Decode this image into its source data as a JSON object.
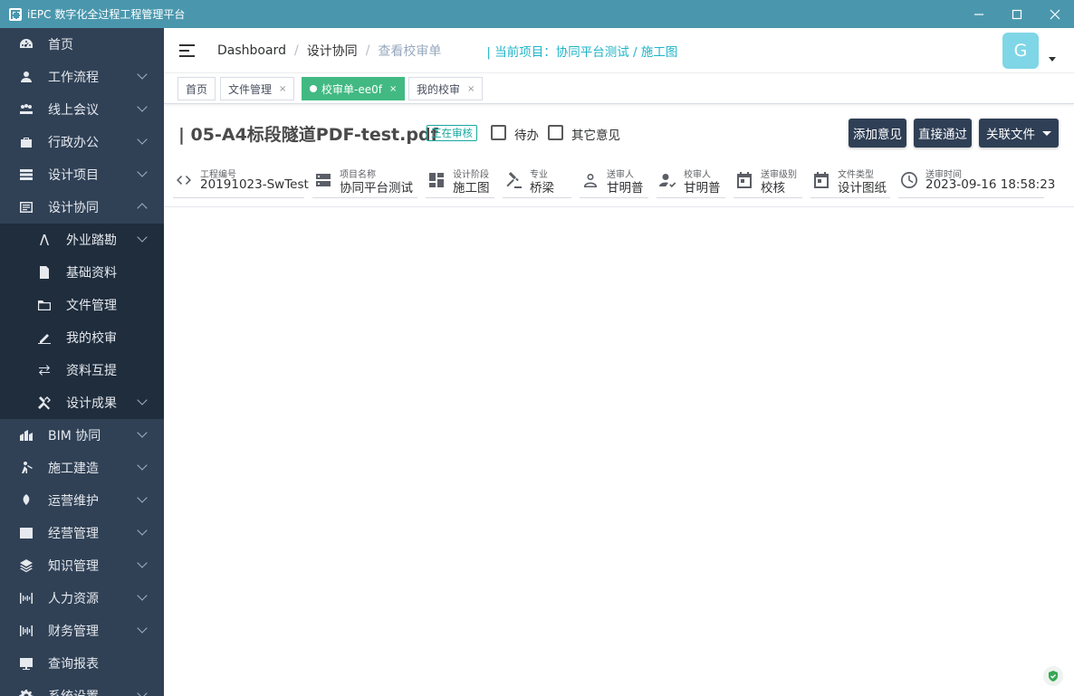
{
  "window": {
    "title": "iEPC 数字化全过程工程管理平台"
  },
  "sidebar": {
    "items": [
      {
        "label": "首页",
        "icon": "dashboard-icon",
        "has_children": false
      },
      {
        "label": "工作流程",
        "icon": "user-icon",
        "has_children": true
      },
      {
        "label": "线上会议",
        "icon": "meeting-icon",
        "has_children": true
      },
      {
        "label": "行政办公",
        "icon": "briefcase-icon",
        "has_children": true
      },
      {
        "label": "设计项目",
        "icon": "list-icon",
        "has_children": true
      },
      {
        "label": "设计协同",
        "icon": "cooperation-icon",
        "has_children": true,
        "expanded": true
      }
    ],
    "subitems": [
      {
        "label": "外业踏勘",
        "icon": "survey-icon",
        "has_children": true
      },
      {
        "label": "基础资料",
        "icon": "document-icon",
        "has_children": false
      },
      {
        "label": "文件管理",
        "icon": "folder-icon",
        "has_children": false
      },
      {
        "label": "我的校审",
        "icon": "sign-icon",
        "has_children": false
      },
      {
        "label": "资料互提",
        "icon": "exchange-icon",
        "has_children": false
      },
      {
        "label": "设计成果",
        "icon": "tools-icon",
        "has_children": true
      }
    ],
    "items_after": [
      {
        "label": "BIM 协同",
        "icon": "bim-icon",
        "has_children": true
      },
      {
        "label": "施工建造",
        "icon": "construction-icon",
        "has_children": true
      },
      {
        "label": "运营维护",
        "icon": "leaf-icon",
        "has_children": true
      },
      {
        "label": "经营管理",
        "icon": "chart-icon",
        "has_children": true
      },
      {
        "label": "知识管理",
        "icon": "layers-icon",
        "has_children": true
      },
      {
        "label": "人力资源",
        "icon": "hr-icon",
        "has_children": true
      },
      {
        "label": "财务管理",
        "icon": "finance-icon",
        "has_children": true
      },
      {
        "label": "查询报表",
        "icon": "report-icon",
        "has_children": false
      },
      {
        "label": "系统设置",
        "icon": "settings-icon",
        "has_children": true
      }
    ]
  },
  "header": {
    "breadcrumb": [
      "Dashboard",
      "设计协同",
      "查看校审单"
    ],
    "project": "| 当前项目：协同平台测试 / 施工图",
    "avatar_letter": "G"
  },
  "tags": [
    {
      "label": "首页",
      "closable": false,
      "active": false
    },
    {
      "label": "文件管理",
      "closable": true,
      "active": false
    },
    {
      "label": "校审单-ee0f",
      "closable": true,
      "active": true
    },
    {
      "label": "我的校审",
      "closable": true,
      "active": false
    }
  ],
  "document": {
    "title": "| 05-A4标段隧道PDF-test.pdf",
    "status": "正在审核",
    "todo_label": "待办",
    "other_label": "其它意见",
    "buttons": {
      "add_opinion": "添加意见",
      "approve": "直接通过",
      "related_files": "关联文件"
    }
  },
  "fields": [
    {
      "label": "工程编号",
      "value": "20191023-SwTest",
      "icon": "code-icon"
    },
    {
      "label": "项目名称",
      "value": "协同平台测试",
      "icon": "server-icon"
    },
    {
      "label": "设计阶段",
      "value": "施工图",
      "icon": "dashboard-grid-icon"
    },
    {
      "label": "专业",
      "value": "桥梁",
      "icon": "gavel-icon"
    },
    {
      "label": "送审人",
      "value": "甘明普",
      "icon": "person-icon"
    },
    {
      "label": "校审人",
      "value": "甘明普",
      "icon": "person-check-icon"
    },
    {
      "label": "送审级别",
      "value": "校核",
      "icon": "calendar-icon"
    },
    {
      "label": "文件类型",
      "value": "设计图纸",
      "icon": "calendar-icon"
    },
    {
      "label": "送审时间",
      "value": "2023-09-16 18:58:23",
      "icon": "clock-icon"
    }
  ],
  "colors": {
    "titlebar": "#4a97ad",
    "sidebar": "#304156",
    "submenu": "#1f2d3d",
    "active_tag": "#42b983",
    "accent": "#1fb4c8",
    "button": "#2f3f55"
  }
}
